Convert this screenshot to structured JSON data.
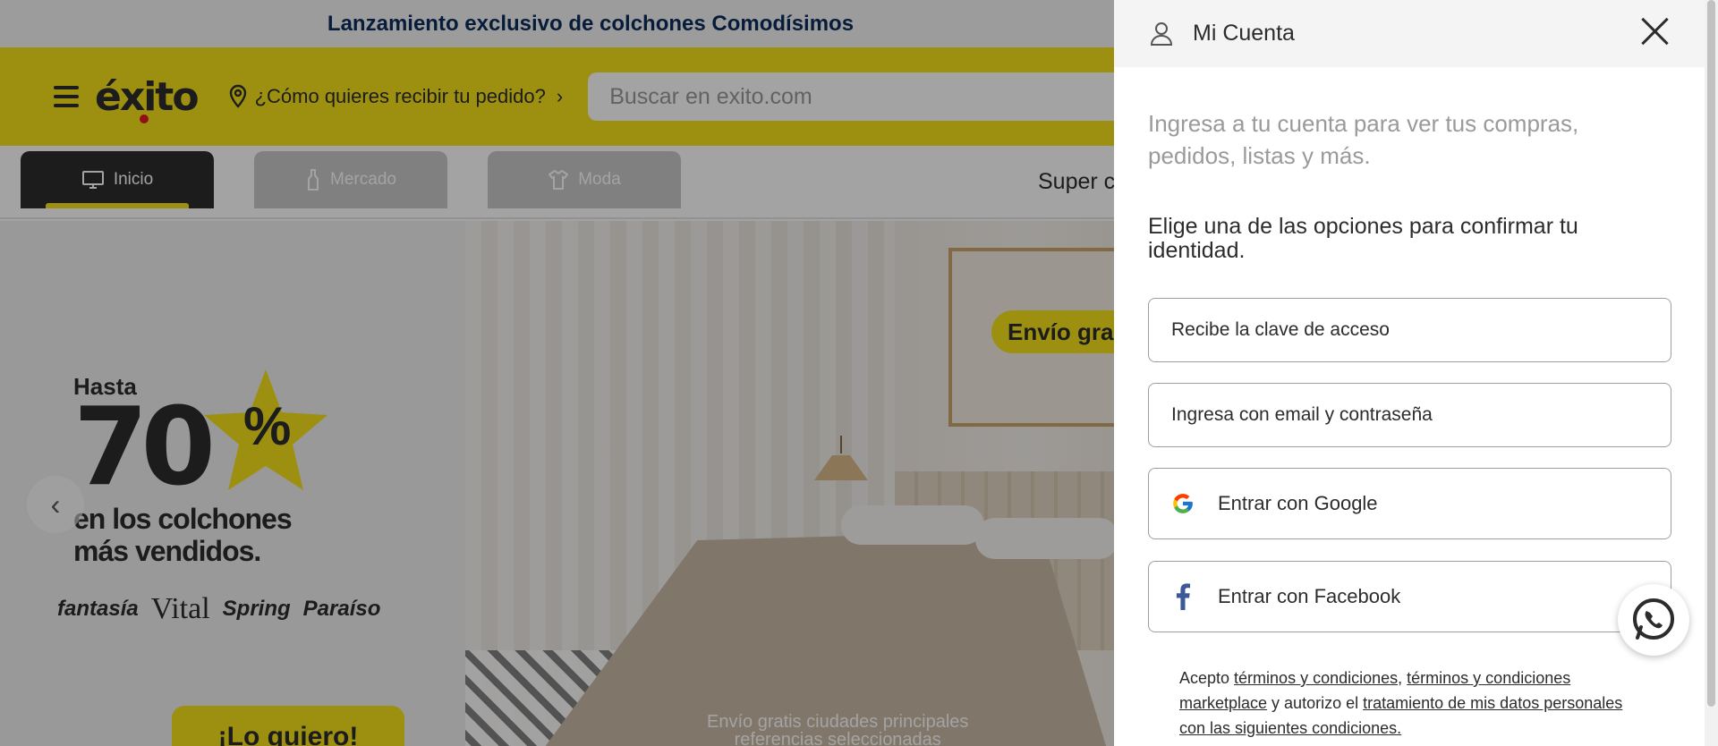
{
  "promo": {
    "text": "Lanzamiento exclusivo de colchones Comodísimos"
  },
  "header": {
    "logo": "éxito",
    "delivery_prompt": "¿Cómo quieres recibir tu pedido?",
    "search_placeholder": "Buscar en exito.com",
    "brand_color": "#f6e11b"
  },
  "nav": {
    "tabs": [
      {
        "label": "Inicio",
        "icon": "monitor-icon",
        "active": true
      },
      {
        "label": "Mercado",
        "icon": "bottle-icon",
        "active": false
      },
      {
        "label": "Moda",
        "icon": "shirt-icon",
        "active": false
      }
    ],
    "super_partial": "Super c"
  },
  "hero": {
    "hasta": "Hasta",
    "big_number": "70",
    "percent": "%",
    "subline1": "en los colchones",
    "subline2": "más vendidos.",
    "brands": [
      "fantasía",
      "Vital",
      "Spring",
      "Paraíso"
    ],
    "cta": "¡Lo quiero!",
    "envio_badge": "Envío gra",
    "envio_note_line1": "Envío gratis ciudades principales",
    "envio_note_line2": "referencias seleccionadas"
  },
  "drawer": {
    "title": "Mi Cuenta",
    "intro": "Ingresa a tu cuenta para ver tus compras, pedidos, listas y más.",
    "prompt": "Elige una de las opciones para confirmar tu identidad.",
    "options": {
      "access_code": "Recibe la clave de acceso",
      "email_password": "Ingresa con email y contraseña",
      "google": "Entrar con Google",
      "facebook": "Entrar con Facebook"
    },
    "terms": {
      "acepto": "Acepto ",
      "link1": "términos y condiciones",
      "comma": ", ",
      "link2": "términos y condiciones marketplace",
      "autorizo": " y autorizo el ",
      "link3": "tratamiento de mis datos personales con las siguientes condiciones."
    }
  }
}
